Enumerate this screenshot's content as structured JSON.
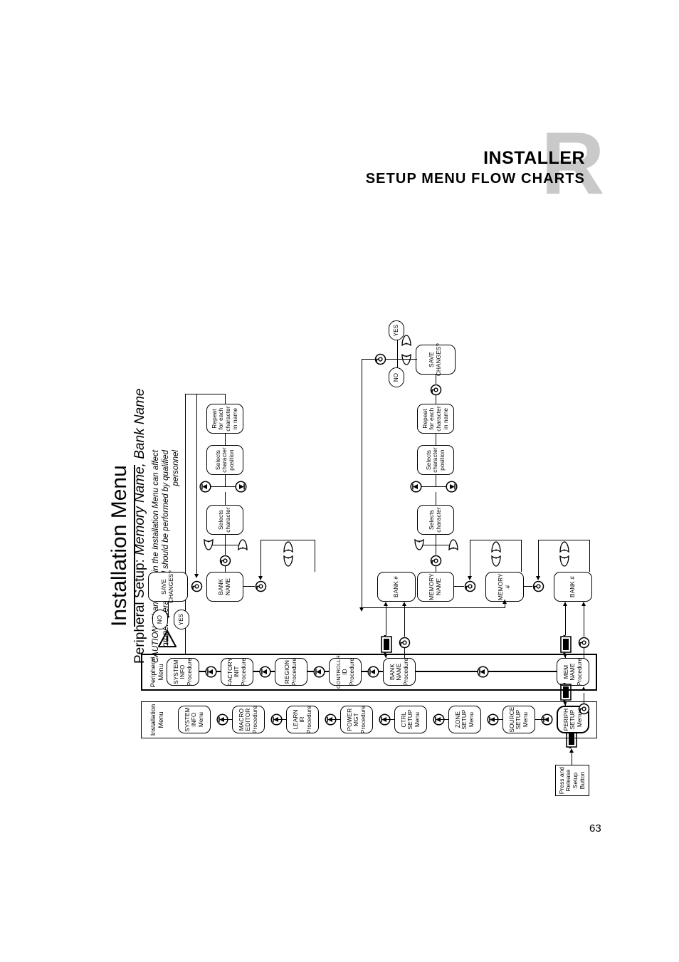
{
  "header": {
    "title": "INSTALLER",
    "subtitle": "SETUP MENU FLOW CHARTS",
    "watermark": "R"
  },
  "caption": {
    "title": "Installation Menu",
    "subtitle_prefix": "Peripheral Setup: ",
    "subtitle_italic": "Memory Name, Bank Name",
    "caution": "CAUTION: Changes within the Installation Menu can affect proper operation and should be performed by qualified personnel",
    "warning_icon": "warning-triangle-icon"
  },
  "page_number": "63",
  "chart_data": {
    "type": "diagram",
    "title": "Installation Menu – Peripheral Setup: Memory Name, Bank Name",
    "columns": [
      {
        "label": "Installation Menu",
        "items": [
          "PERIPH SETUP Menu",
          "SOURCE SETUP Menu",
          "ZONE SETUP Menu",
          "CTRL SETUP Menu",
          "POWER MGT Procedure",
          "LEARN IR Procedure",
          "MACRO EDITOR Procedure",
          "SYSTEM INFO Menu"
        ]
      },
      {
        "label": "Peripheral Menu",
        "items": [
          "MEM NAME Procedure",
          "BANK NAME Procedure",
          "CONTROLLR ID Procedure",
          "REGION Procedure",
          "FACTORY INIT Procedure",
          "SYSTEM INFO Procedure"
        ]
      }
    ]
  },
  "start": {
    "label": "Press and Release Setup Button"
  },
  "menu1": {
    "label": "Installation Menu",
    "n0_l1": "PERIPH",
    "n0_l2": "SETUP",
    "n0_l3": "Menu",
    "n1_l1": "SOURCE",
    "n1_l2": "SETUP",
    "n1_l3": "Menu",
    "n2_l1": "ZONE",
    "n2_l2": "SETUP",
    "n2_l3": "Menu",
    "n3_l1": "CTRL",
    "n3_l2": "SETUP",
    "n3_l3": "Menu",
    "n4_l1": "POWER",
    "n4_l2": "MGT",
    "n4_l3": "Procedure",
    "n5_l1": "LEARN IR",
    "n5_l2": "Procedure",
    "n6_l1": "MACRO",
    "n6_l2": "EDITOR",
    "n6_l3": "Procedure",
    "n7_l1": "SYSTEM",
    "n7_l2": "INFO",
    "n7_l3": "Menu"
  },
  "menu2": {
    "label": "Peripheral Menu",
    "m0_l1": "MEM",
    "m0_l2": "NAME",
    "m0_l3": "Procedure",
    "m1_l1": "BANK",
    "m1_l2": "NAME",
    "m1_l3": "Procedure",
    "m2_l1": "CONTROLLR",
    "m2_l2": "ID",
    "m2_l3": "Procedure",
    "m3_l1": "REGION",
    "m3_l2": "Procedure",
    "m4_l1": "FACTORY",
    "m4_l2": "INIT",
    "m4_l3": "Procedure",
    "m5_l1": "SYSTEM",
    "m5_l2": "INFO",
    "m5_l3": "Procedure"
  },
  "bank_branch": {
    "bank_num": "BANK #",
    "bank_name_l1": "BANK",
    "bank_name_l2": "NAME",
    "sel_char_l1": "Selects",
    "sel_char_l2": "character",
    "sel_pos_l1": "Selects",
    "sel_pos_l2": "character",
    "sel_pos_l3": "position",
    "repeat_l1": "Repeat",
    "repeat_l2": "for each",
    "repeat_l3": "character",
    "repeat_l4": "in name",
    "save_l1": "SAVE",
    "save_l2": "CHANGES?",
    "no": "NO",
    "yes": "YES"
  },
  "mem_branch": {
    "bank_num": "BANK #",
    "mem_num": "MEMORY #",
    "mem_name_l1": "MEMORY",
    "mem_name_l2": "NAME",
    "sel_char_l1": "Selects",
    "sel_char_l2": "character",
    "sel_pos_l1": "Selects",
    "sel_pos_l2": "character",
    "sel_pos_l3": "position",
    "repeat_l1": "Repeat",
    "repeat_l2": "for each",
    "repeat_l3": "character",
    "repeat_l4": "in name",
    "save_l1": "SAVE",
    "save_l2": "CHANGES?",
    "no": "NO",
    "yes": "YES"
  },
  "icons": {
    "setup_button": "setup-button-icon",
    "enter_button": "enter-button-icon",
    "up_button": "up-arrow-button-icon",
    "down_button": "down-arrow-button-icon",
    "left_leaf": "left-selector-icon",
    "right_leaf": "right-selector-icon"
  }
}
